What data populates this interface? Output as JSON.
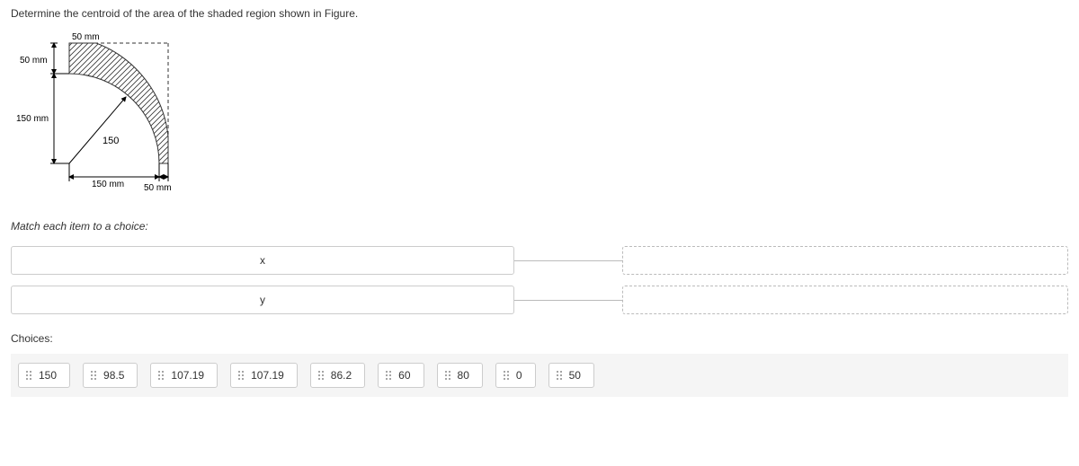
{
  "question": "Determine the centroid of the area of the shaded region shown in Figure.",
  "figure": {
    "dim_top": "50 mm",
    "dim_left_upper": "50 mm",
    "dim_left_lower": "150 mm",
    "radius_inner": "150",
    "dim_bottom_left": "150 mm",
    "dim_bottom_right": "50 mm"
  },
  "match": {
    "instruction": "Match each item to a choice:",
    "items": [
      "x",
      "y"
    ]
  },
  "choices": {
    "label": "Choices:",
    "options": [
      "150",
      "98.5",
      "107.19",
      "107.19",
      "86.2",
      "60",
      "80",
      "0",
      "50"
    ]
  }
}
